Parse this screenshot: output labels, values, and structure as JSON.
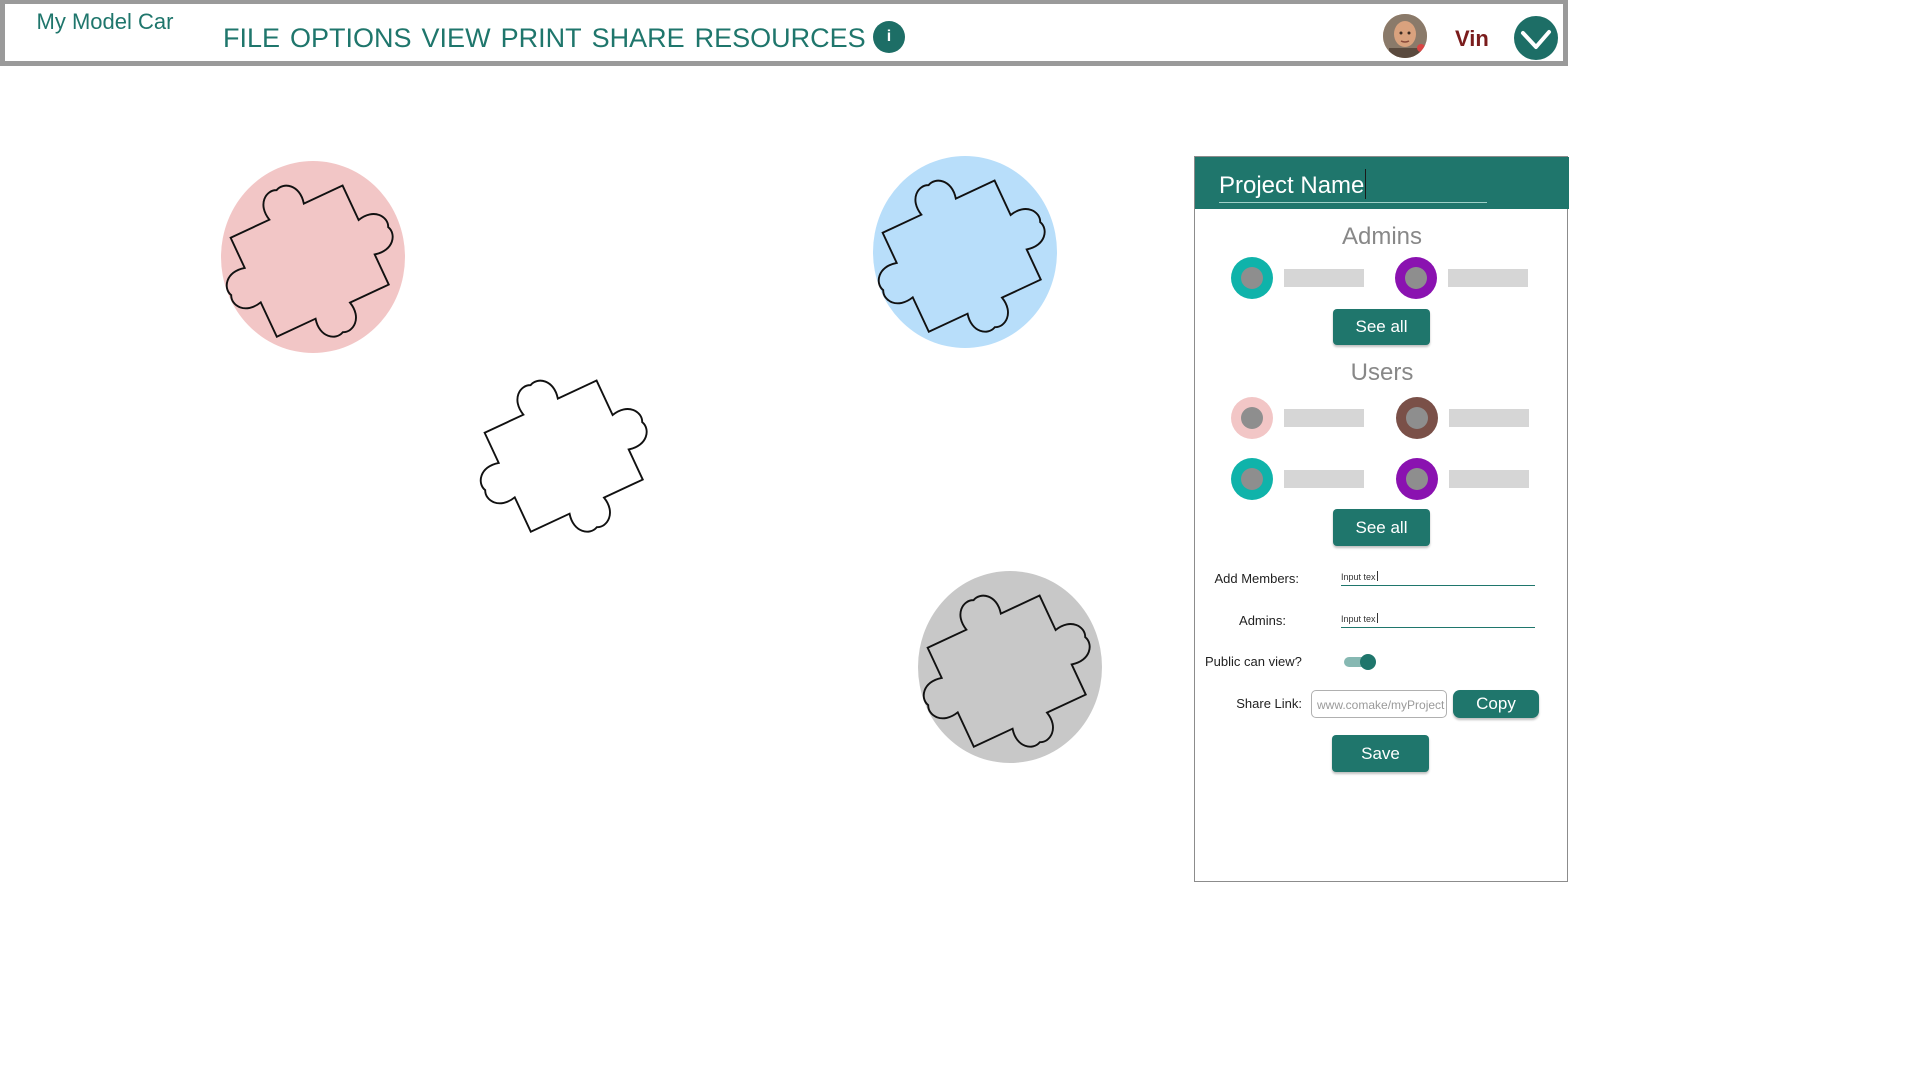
{
  "app": {
    "title": "My Model Car"
  },
  "menu": {
    "items": [
      {
        "label": "FILE"
      },
      {
        "label": "OPTIONS"
      },
      {
        "label": "VIEW"
      },
      {
        "label": "PRINT"
      },
      {
        "label": "SHARE"
      },
      {
        "label": "RESOURCES"
      }
    ],
    "info_label": "i"
  },
  "user": {
    "name": "Vin"
  },
  "puzzles": [
    {
      "name": "puzzle-piece-red",
      "color": "#f2c6c6"
    },
    {
      "name": "puzzle-piece-blue",
      "color": "#b8defa"
    },
    {
      "name": "puzzle-piece-plain",
      "color": "none"
    },
    {
      "name": "puzzle-piece-gray",
      "color": "#c8c8c8"
    }
  ],
  "panel": {
    "project_name": "Project Name",
    "admins_title": "Admins",
    "admins": [
      {
        "ring_color": "#0fb3aa"
      },
      {
        "ring_color": "#8a12b0"
      }
    ],
    "users_title": "Users",
    "users": [
      {
        "ring_color": "#f2c6c6"
      },
      {
        "ring_color": "#7a5048"
      },
      {
        "ring_color": "#0fb3aa"
      },
      {
        "ring_color": "#8a12b0"
      }
    ],
    "see_all_label": "See all",
    "add_members_label": "Add Members:",
    "add_members_value": "Input tex",
    "admins_label": "Admins:",
    "admins_value": "Input tex",
    "public_view_label": "Public can view?",
    "public_view_on": true,
    "share_link_label": "Share Link:",
    "share_link_value": "www.comake/myProject",
    "copy_label": "Copy",
    "save_label": "Save"
  },
  "colors": {
    "accent": "#1f766c",
    "user_name": "#7a1c1c"
  }
}
